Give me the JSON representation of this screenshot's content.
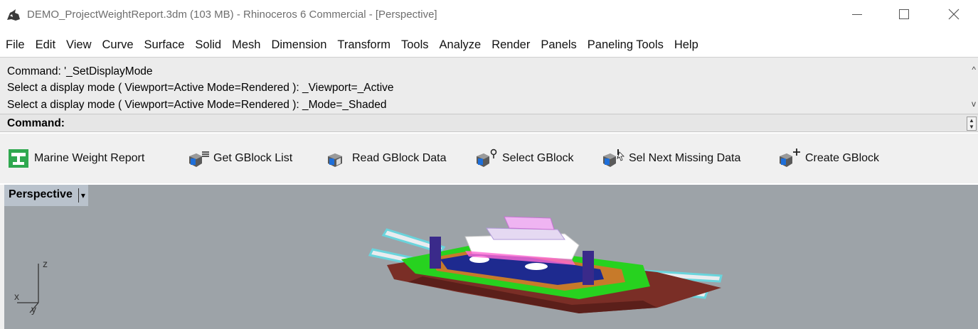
{
  "window": {
    "title": "DEMO_ProjectWeightReport.3dm (103 MB) - Rhinoceros 6 Commercial - [Perspective]",
    "minimize": "—",
    "maximize": "☐",
    "close": "✕"
  },
  "menu": {
    "items": [
      "File",
      "Edit",
      "View",
      "Curve",
      "Surface",
      "Solid",
      "Mesh",
      "Dimension",
      "Transform",
      "Tools",
      "Analyze",
      "Render",
      "Panels",
      "Paneling Tools",
      "Help"
    ]
  },
  "command_history": {
    "lines": [
      "Command: '_SetDisplayMode",
      "Select a display mode ( Viewport=Active  Mode=Rendered ): _Viewport=_Active",
      "Select a display mode ( Viewport=Active  Mode=Rendered ): _Mode=_Shaded"
    ],
    "scroll_up": "^",
    "scroll_down": "v"
  },
  "command_prompt": {
    "label": "Command:"
  },
  "toolbar": {
    "buttons": [
      {
        "label": "Marine Weight Report",
        "icon": "marine-weight-report-icon"
      },
      {
        "label": "Get GBlock List",
        "icon": "get-gblock-list-icon"
      },
      {
        "label": "Read GBlock Data",
        "icon": "read-gblock-data-icon"
      },
      {
        "label": "Select GBlock",
        "icon": "select-gblock-icon"
      },
      {
        "label": "Sel Next Missing Data",
        "icon": "sel-next-missing-data-icon"
      },
      {
        "label": "Create GBlock",
        "icon": "create-gblock-icon"
      }
    ]
  },
  "viewport": {
    "name": "Perspective",
    "dropdown_arrow": "▾",
    "background_color": "#9da3a8",
    "axes": {
      "x": "x",
      "y": "y",
      "z": "z"
    }
  }
}
